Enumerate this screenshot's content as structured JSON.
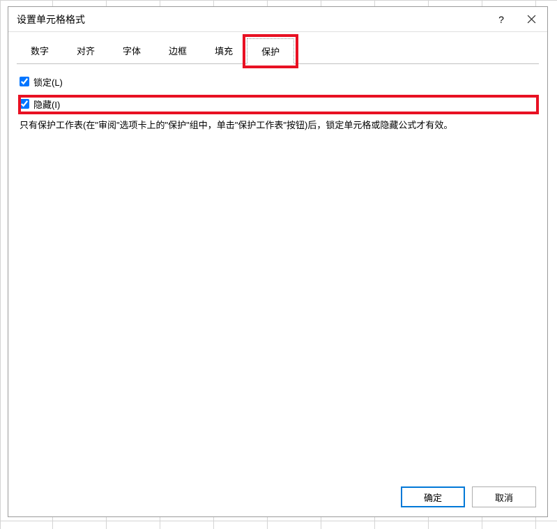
{
  "dialog": {
    "title": "设置单元格格式",
    "help_symbol": "?"
  },
  "tabs": {
    "number": "数字",
    "alignment": "对齐",
    "font": "字体",
    "border": "边框",
    "fill": "填充",
    "protection": "保护"
  },
  "protection": {
    "locked_label": "锁定(L)",
    "hidden_label": "隐藏(I)",
    "info_text": "只有保护工作表(在\"审阅\"选项卡上的\"保护\"组中，单击\"保护工作表\"按钮)后，锁定单元格或隐藏公式才有效。"
  },
  "buttons": {
    "ok": "确定",
    "cancel": "取消"
  },
  "highlight_color": "#e81123"
}
